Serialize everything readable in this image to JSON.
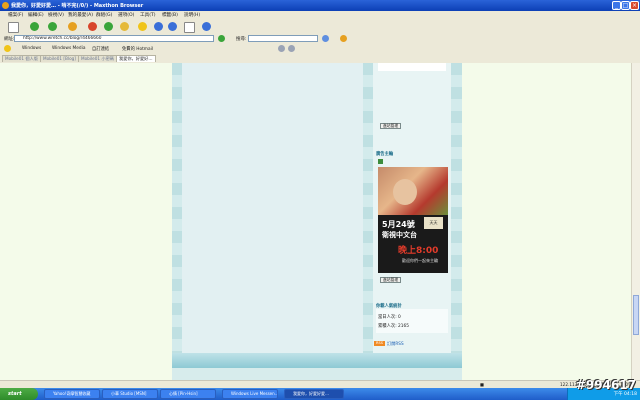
{
  "window": {
    "title": "我愛你，好愛好愛… - 啃不完(/0/) - Maxthon Browser",
    "controls": [
      "_",
      "□",
      "×"
    ]
  },
  "menu": [
    "檔案(F)",
    "編輯(E)",
    "檢視(V)",
    "我的最愛(A)",
    "群組(G)",
    "選項(O)",
    "工具(T)",
    "標籤(B)",
    "說明(H)"
  ],
  "address": {
    "label": "網址:",
    "url": "http://www.wretch.cc/blog/r4466660",
    "search_label": "搜尋:",
    "search_value": ""
  },
  "links": [
    "Windows",
    "Windows Media",
    "自訂連結",
    "免費的 Hotmail"
  ],
  "tabs": [
    {
      "label": "Mobile01 個人版"
    },
    {
      "label": "Mobile01 [Blog]"
    },
    {
      "label": "Mobile01 小密碼"
    },
    {
      "label": "我愛你，好愛好…",
      "active": true
    }
  ],
  "page": {
    "manage_button_1": "進站管理",
    "sponsor_title": "廣告主輪",
    "ad": {
      "date": "5月24號",
      "channel": "衛視中文台",
      "time": "晚上8:00",
      "tagline": "歡迎你們一起來主輪",
      "logo": "天天"
    },
    "manage_button_2": "進站管理",
    "stats": {
      "title": "你載人氣統計",
      "today_label": "當日人次",
      "today_value": "0",
      "total_label": "累積人次",
      "total_value": "2165"
    },
    "rss_badge": "RSS",
    "rss_text": "訂閱RSS"
  },
  "statusbar": {
    "ip": "122.117.240.51",
    "speed": "0KB/s",
    "zoom": "100%"
  },
  "taskbar": {
    "start_label": "start",
    "tasks": [
      {
        "label": "Yahoo!奇摩智慧收藏"
      },
      {
        "label": "小華 Studio [MSN]"
      },
      {
        "label": "心情 [Pin-Hsin]"
      },
      {
        "label": "Windows Live Messen..."
      },
      {
        "label": "我愛你，好愛好愛…",
        "active": true
      }
    ],
    "clock": "下午 04:18"
  },
  "watermark": "#994617"
}
